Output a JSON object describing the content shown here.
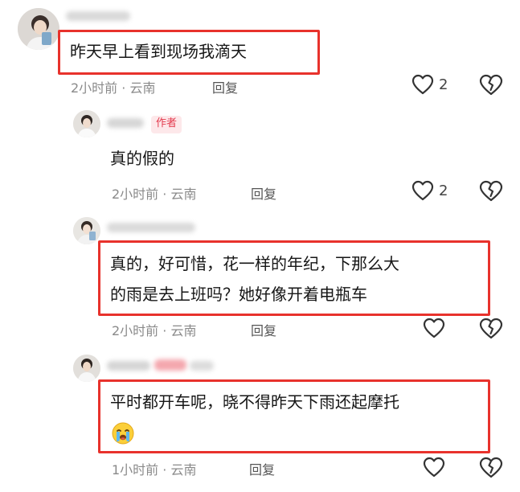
{
  "comments": [
    {
      "text": "昨天早上看到现场我滴天",
      "time": "2小时前",
      "sep": "·",
      "location": "云南",
      "reply": "回复",
      "likes": "2"
    },
    {
      "badge": "作者",
      "text": "真的假的",
      "time": "2小时前",
      "sep": "·",
      "location": "云南",
      "reply": "回复",
      "likes": "2"
    },
    {
      "text_line1": "真的，好可惜，花一样的年纪，下那么大",
      "text_line2": "的雨是去上班吗？她好像开着电瓶车",
      "time": "2小时前",
      "sep": "·",
      "location": "云南",
      "reply": "回复"
    },
    {
      "text_line1": "平时都开车呢，晓不得昨天下雨还起摩托",
      "time": "1小时前",
      "sep": "·",
      "location": "云南",
      "reply": "回复"
    }
  ],
  "icons": {
    "like": "heart-outline-icon",
    "dislike": "broken-heart-icon",
    "emoji": "crying-face-icon"
  },
  "colors": {
    "highlight": "#e8322c",
    "badge_bg": "#fde8ea",
    "badge_text": "#e33a4d",
    "meta": "#8a8a8a"
  }
}
